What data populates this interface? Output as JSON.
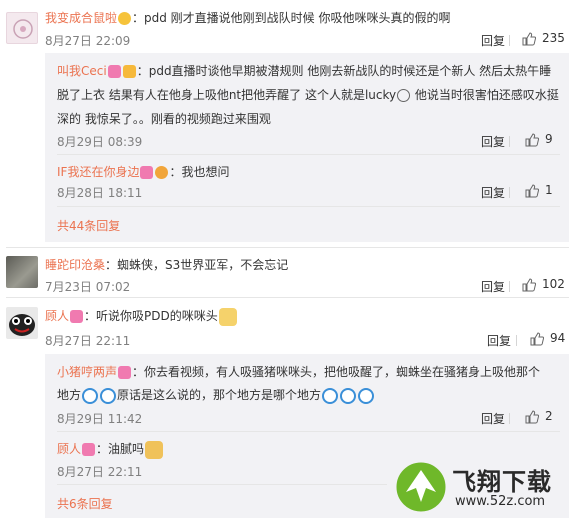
{
  "comments": [
    {
      "user": "我变成合鼠啦",
      "text": "：pdd 刚才直播说他刚到战队时候 你吸他咪咪头真的假的啊",
      "time": "8月27日 22:09",
      "reply_label": "回复",
      "likes": "235"
    },
    {
      "user": "睡跎印沧桑",
      "text": "：蜘蛛侠，S3世界亚军，不会忘记",
      "time": "7月23日 07:02",
      "reply_label": "回复",
      "likes": "102"
    },
    {
      "user": "顾人",
      "text": "：听说你吸PDD的咪咪头",
      "time": "8月27日 22:11",
      "reply_label": "回复",
      "likes": "94"
    }
  ],
  "replies_1": [
    {
      "user": "叫我Ceci",
      "text_line1": "：pdd直播时谈他早期被潜规则 他刚去新战队的时候还是个新人 然后太热午睡",
      "text_line2": "脱了上衣 结果有人在他身上吸他nt把他弄醒了 这个人就是lucky",
      "text_line2b": " 他说当时很害怕还感叹水挺",
      "text_line3": "深的 我惊呆了。。刚看的视频跑过来围观",
      "time": "8月29日 08:39",
      "reply_label": "回复",
      "likes": "9"
    },
    {
      "user": "IF我还在你身边",
      "text": "：我也想问",
      "time": "8月28日 18:11",
      "reply_label": "回复",
      "likes": "1"
    }
  ],
  "more_1": "共44条回复",
  "replies_3": [
    {
      "user": "小猪哼两声",
      "text_line1": "：你去看视频，有人吸骚猪咪咪头，把他吸醒了，蜘蛛坐在骚猪身上吸他那个",
      "text_line2a": "地方",
      "text_line2b": "原话是这么说的，那个地方是哪个地方",
      "time": "8月29日 11:42",
      "reply_label": "回复",
      "likes": "2"
    },
    {
      "user": "顾人",
      "text": "：油腻吗",
      "time": "8月27日 22:11"
    }
  ],
  "more_3": "共6条回复",
  "watermark": {
    "title": "飞翔下载",
    "url": "www.52z.com"
  }
}
